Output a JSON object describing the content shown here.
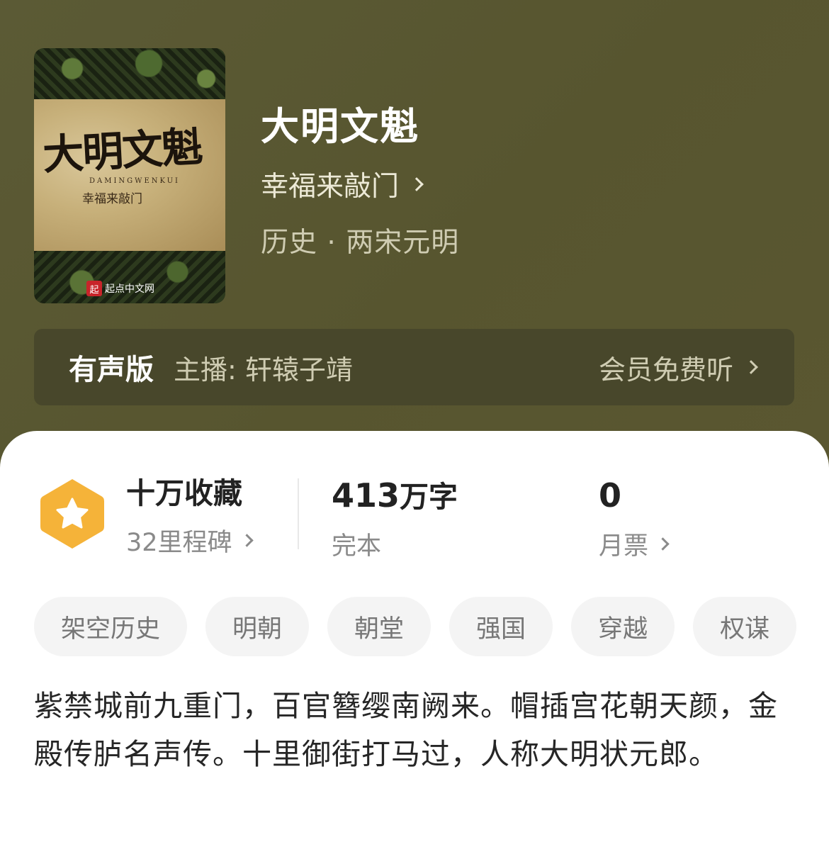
{
  "book": {
    "title": "大明文魁",
    "author": "幸福来敲门",
    "category": "历史 · 两宋元明",
    "cover_title": "大明文魁",
    "cover_pinyin": "DAMINGWENKUI",
    "cover_author": "幸福来敲门",
    "cover_publisher": "起点中文网",
    "cover_badge": "起"
  },
  "audio": {
    "label": "有声版",
    "narrator_prefix": "主播:",
    "narrator": "轩辕子靖",
    "action": "会员免费听"
  },
  "stats": [
    {
      "value": "十万收藏",
      "sub": "32里程碑",
      "arrow": true
    },
    {
      "value_num": "413",
      "value_unit": "万字",
      "sub": "完本",
      "arrow": false
    },
    {
      "value": "0",
      "sub": "月票",
      "arrow": true
    }
  ],
  "tags": [
    "架空历史",
    "明朝",
    "朝堂",
    "强国",
    "穿越",
    "权谋"
  ],
  "description": "紫禁城前九重门，百官簪缨南阙来。帽插宫花朝天颜，金殿传胪名声传。十里御街打马过，人称大明状元郎。",
  "colors": {
    "header_bg": "#5a5834",
    "badge": "#f5b339",
    "text_dark": "#222222",
    "text_gray": "#8a8a8a"
  }
}
